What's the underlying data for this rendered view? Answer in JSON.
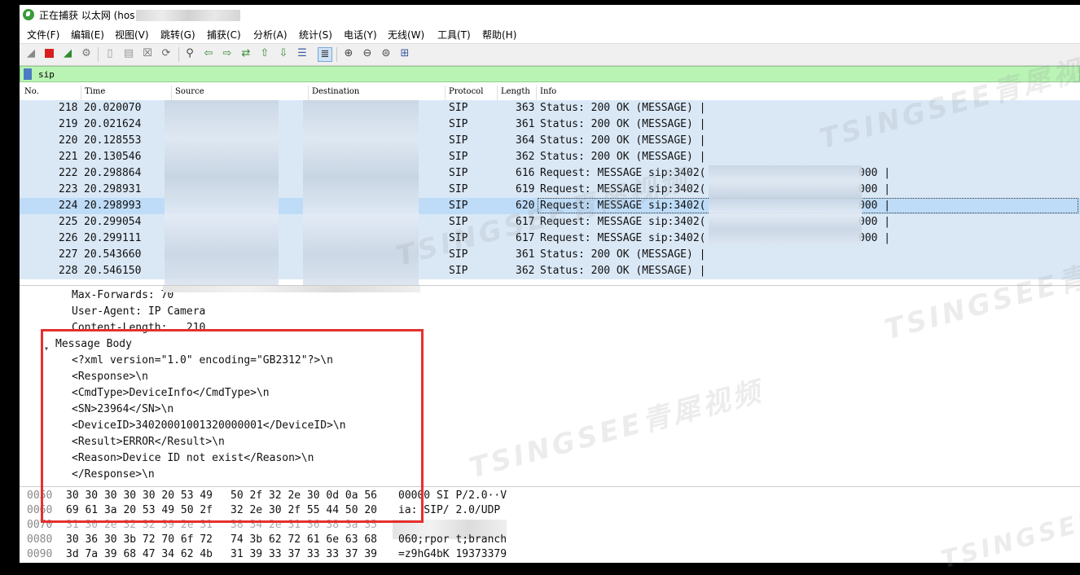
{
  "window": {
    "title": "正在捕获 以太网 (hos"
  },
  "menu": [
    "文件(F)",
    "编辑(E)",
    "视图(V)",
    "跳转(G)",
    "捕获(C)",
    "分析(A)",
    "统计(S)",
    "电话(Y)",
    "无线(W)",
    "工具(T)",
    "帮助(H)"
  ],
  "toolbar_icons": [
    "shark-fin-icon",
    "stop-icon",
    "restart-icon",
    "options-gear-icon",
    "open-file-icon",
    "save-file-icon",
    "close-file-icon",
    "reload-icon",
    "find-icon",
    "back-icon",
    "forward-icon",
    "go-to-packet-icon",
    "first-packet-icon",
    "last-packet-icon",
    "auto-scroll-icon",
    "colorize-icon",
    "zoom-in-icon",
    "zoom-out-icon",
    "normal-size-icon",
    "resize-columns-icon"
  ],
  "filter": {
    "value": "sip"
  },
  "columns": [
    "No.",
    "Time",
    "Source",
    "Destination",
    "Protocol",
    "Length",
    "Info"
  ],
  "packets": [
    {
      "no": "218",
      "time": "20.020070",
      "protocol": "SIP",
      "length": "363",
      "info": "Status: 200 OK (MESSAGE) |"
    },
    {
      "no": "219",
      "time": "20.021624",
      "protocol": "SIP",
      "length": "361",
      "info": "Status: 200 OK (MESSAGE) |"
    },
    {
      "no": "220",
      "time": "20.128553",
      "protocol": "SIP",
      "length": "364",
      "info": "Status: 200 OK (MESSAGE) |"
    },
    {
      "no": "221",
      "time": "20.130546",
      "protocol": "SIP",
      "length": "362",
      "info": "Status: 200 OK (MESSAGE) |"
    },
    {
      "no": "222",
      "time": "20.298864",
      "protocol": "SIP",
      "length": "616",
      "info": "Request: MESSAGE sip:3402(",
      "info_tail": "000 |"
    },
    {
      "no": "223",
      "time": "20.298931",
      "protocol": "SIP",
      "length": "619",
      "info": "Request: MESSAGE sip:3402(",
      "info_tail": "000 |"
    },
    {
      "no": "224",
      "time": "20.298993",
      "protocol": "SIP",
      "length": "620",
      "info": "Request: MESSAGE sip:3402(",
      "info_tail": "000 |"
    },
    {
      "no": "225",
      "time": "20.299054",
      "protocol": "SIP",
      "length": "617",
      "info": "Request: MESSAGE sip:3402(",
      "info_tail": "000 |"
    },
    {
      "no": "226",
      "time": "20.299111",
      "protocol": "SIP",
      "length": "617",
      "info": "Request: MESSAGE sip:3402(",
      "info_tail": "000 |"
    },
    {
      "no": "227",
      "time": "20.543660",
      "protocol": "SIP",
      "length": "361",
      "info": "Status: 200 OK (MESSAGE) |"
    },
    {
      "no": "228",
      "time": "20.546150",
      "protocol": "SIP",
      "length": "362",
      "info": "Status: 200 OK (MESSAGE) |"
    }
  ],
  "details": {
    "max_forwards": "Max-Forwards: 70",
    "user_agent": "User-Agent: IP Camera",
    "content_length": "Content-Length:   210",
    "message_body_label": "Message Body",
    "body_lines": [
      "<?xml version=\"1.0\" encoding=\"GB2312\"?>\\n",
      "<Response>\\n",
      "<CmdType>DeviceInfo</CmdType>\\n",
      "<SN>23964</SN>\\n",
      "<DeviceID>34020001001320000001</DeviceID>\\n",
      "<Result>ERROR</Result>\\n",
      "<Reason>Device ID not exist</Reason>\\n",
      "</Response>\\n"
    ]
  },
  "bytes": [
    {
      "offset": "0050",
      "hex1": "30 30 30 30 30 20 53 49",
      "hex2": "50 2f 32 2e 30 0d 0a 56",
      "ascii": "00000 SI P/2.0··V"
    },
    {
      "offset": "0060",
      "hex1": "69 61 3a 20 53 49 50 2f",
      "hex2": "32 2e 30 2f 55 44 50 20",
      "ascii": "ia: SIP/ 2.0/UDP "
    },
    {
      "offset": "0070",
      "hex1": "31 30 2e 32 32 39 2e 31",
      "hex2": "38 34 2e 31 36 38 3a 35",
      "ascii": ""
    },
    {
      "offset": "0080",
      "hex1": "30 36 30 3b 72 70 6f 72",
      "hex2": "74 3b 62 72 61 6e 63 68",
      "ascii": "060;rpor t;branch"
    },
    {
      "offset": "0090",
      "hex1": "3d 7a 39 68 47 34 62 4b",
      "hex2": "31 39 33 37 33 33 37 39",
      "ascii": "=z9hG4bK 19373379"
    }
  ],
  "watermark": "TSINGSEE青犀视频",
  "colors": {
    "row_bg": "#dae8f6",
    "row_selected": "#bedcf8",
    "filter_bg": "#b9f4b5",
    "highlight_box": "#e6302c"
  }
}
